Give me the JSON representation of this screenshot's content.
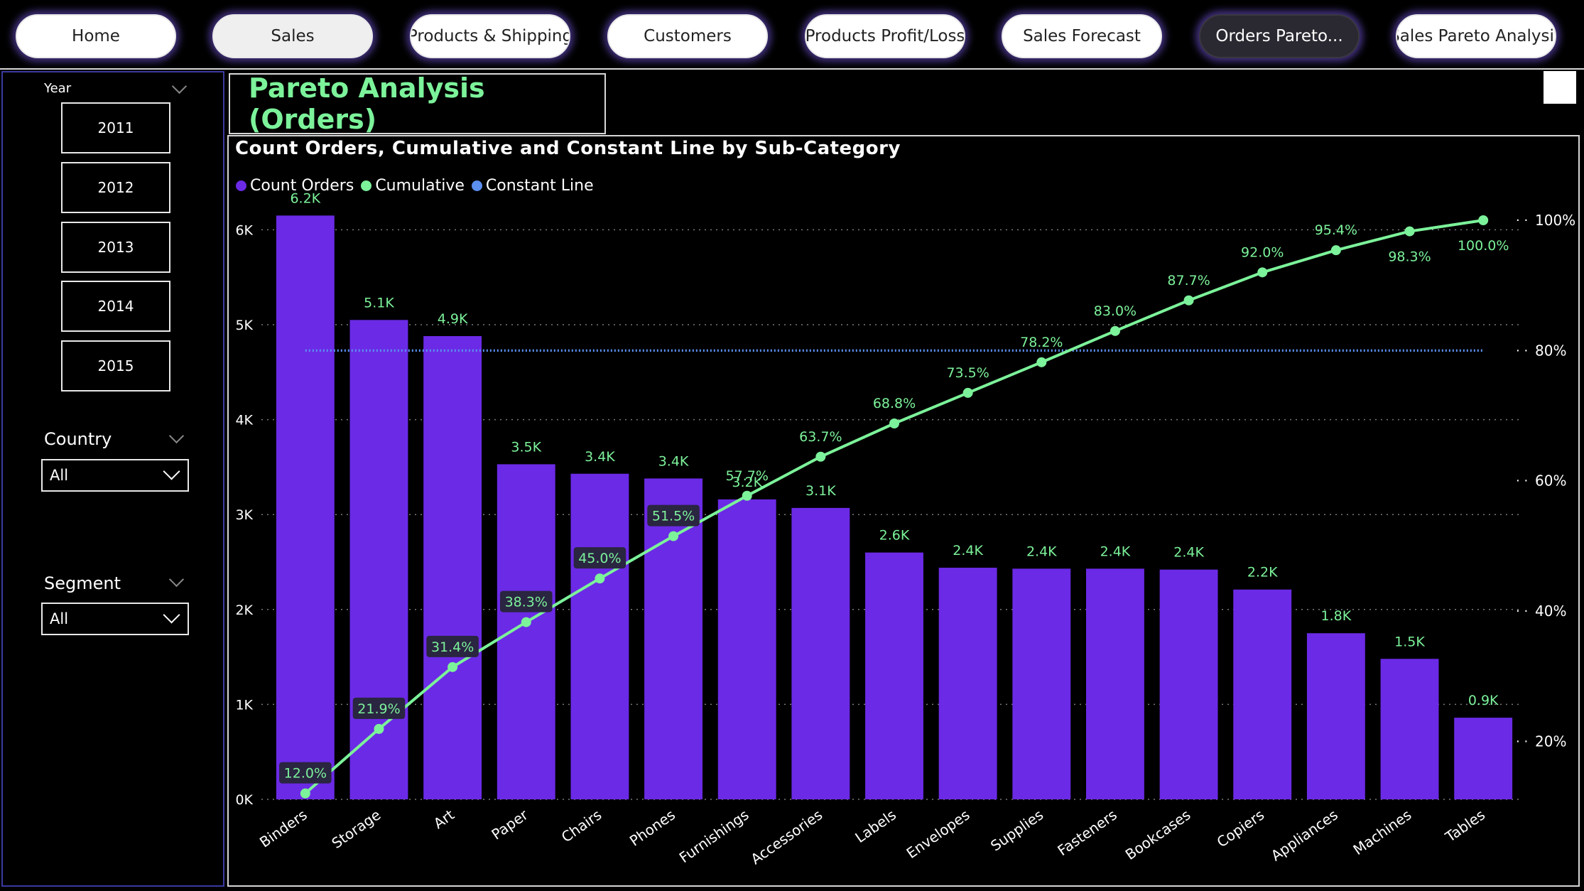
{
  "nav": {
    "buttons": [
      "Home",
      "Sales",
      "Products & Shipping",
      "Customers",
      "Products Profit/Loss",
      "Sales Forecast",
      "Orders Pareto...",
      "Sales Pareto Analysis"
    ],
    "active_index": 6
  },
  "filters": {
    "year": {
      "title": "Year",
      "options": [
        "2011",
        "2012",
        "2013",
        "2014",
        "2015"
      ]
    },
    "country": {
      "title": "Country",
      "value": "All"
    },
    "segment": {
      "title": "Segment",
      "value": "All"
    }
  },
  "page_title": "Pareto Analysis (Orders)",
  "colors": {
    "bar": "#6b2ae6",
    "cumulative": "#7cf29a",
    "constant": "#5b8ff0",
    "title": "#7cf29a",
    "grid": "#7a7a7a"
  },
  "chart_data": {
    "type": "bar",
    "title": "Count Orders, Cumulative and Constant Line by Sub-Category",
    "legend": [
      "Count Orders",
      "Cumulative",
      "Constant Line"
    ],
    "legend_position": "top-left",
    "grid": true,
    "categories": [
      "Binders",
      "Storage",
      "Art",
      "Paper",
      "Chairs",
      "Phones",
      "Furnishings",
      "Accessories",
      "Labels",
      "Envelopes",
      "Supplies",
      "Fasteners",
      "Bookcases",
      "Copiers",
      "Appliances",
      "Machines",
      "Tables"
    ],
    "series": [
      {
        "name": "Count Orders",
        "type": "bar",
        "axis": "left",
        "values": [
          6150,
          5050,
          4880,
          3530,
          3430,
          3380,
          3160,
          3070,
          2600,
          2440,
          2430,
          2430,
          2420,
          2210,
          1750,
          1480,
          860
        ],
        "labels": [
          "6.2K",
          "5.1K",
          "4.9K",
          "3.5K",
          "3.4K",
          "3.4K",
          "3.2K",
          "3.1K",
          "2.6K",
          "2.4K",
          "2.4K",
          "2.4K",
          "2.4K",
          "2.2K",
          "1.8K",
          "1.5K",
          "0.9K"
        ]
      },
      {
        "name": "Cumulative",
        "type": "line",
        "axis": "right",
        "values": [
          12.0,
          21.9,
          31.4,
          38.3,
          45.0,
          51.5,
          57.7,
          63.7,
          68.8,
          73.5,
          78.2,
          83.0,
          87.7,
          92.0,
          95.4,
          98.3,
          100.0
        ],
        "labels": [
          "12.0%",
          "21.9%",
          "31.4%",
          "38.3%",
          "45.0%",
          "51.5%",
          "57.7%",
          "63.7%",
          "68.8%",
          "73.5%",
          "78.2%",
          "83.0%",
          "87.7%",
          "92.0%",
          "95.4%",
          "98.3%",
          "100.0%"
        ]
      },
      {
        "name": "Constant Line",
        "type": "line",
        "axis": "right",
        "value": 80
      }
    ],
    "y_left": {
      "ylim": [
        0,
        6250
      ],
      "ticks": [
        0,
        1000,
        2000,
        3000,
        4000,
        5000,
        6000
      ],
      "tick_labels": [
        "0K",
        "1K",
        "2K",
        "3K",
        "4K",
        "5K",
        "6K"
      ]
    },
    "y_right": {
      "ylim": [
        10,
        100
      ],
      "ticks": [
        20,
        40,
        60,
        80,
        100
      ],
      "tick_labels": [
        "20%",
        "40%",
        "60%",
        "80%",
        "100%"
      ]
    }
  }
}
